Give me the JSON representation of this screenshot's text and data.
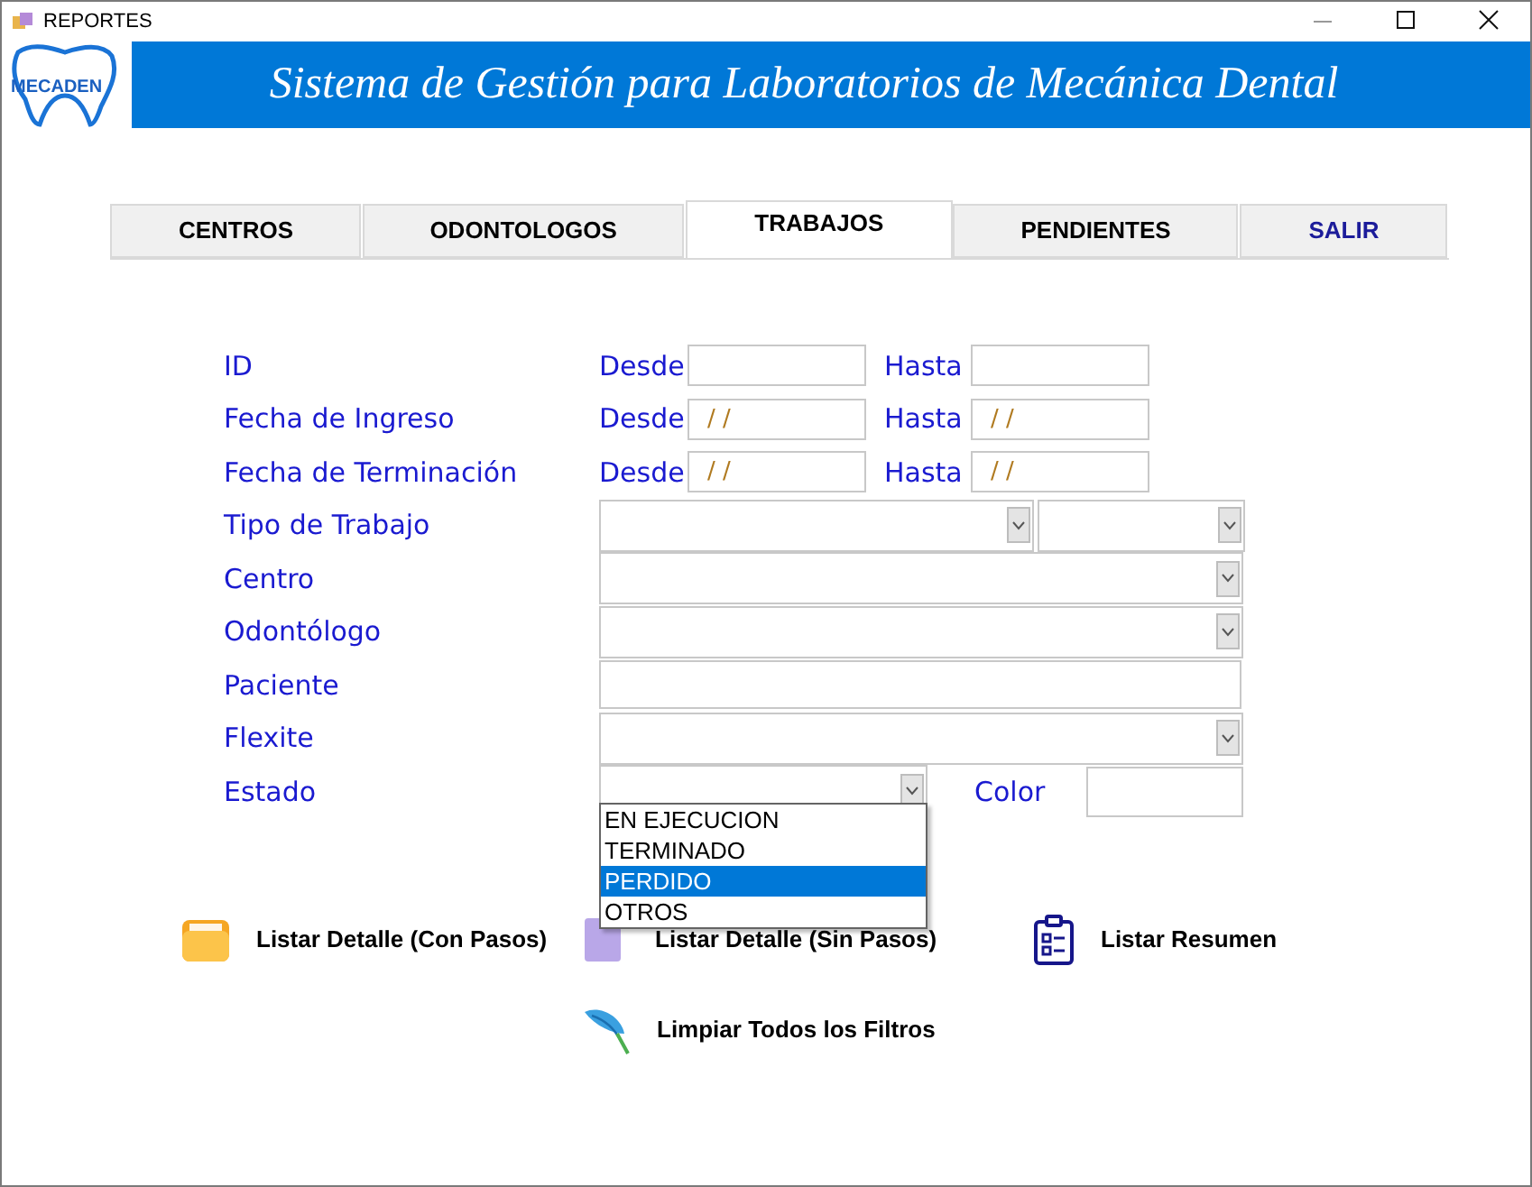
{
  "window": {
    "title": "REPORTES"
  },
  "banner": {
    "logo_text": "MECADEN",
    "title": "Sistema de Gestión para Laboratorios de Mecánica Dental"
  },
  "tabs": [
    {
      "label": "CENTROS",
      "selected": false,
      "kind": "tab"
    },
    {
      "label": "ODONTOLOGOS",
      "selected": false,
      "kind": "tab"
    },
    {
      "label": "TRABAJOS",
      "selected": true,
      "kind": "tab"
    },
    {
      "label": "PENDIENTES",
      "selected": false,
      "kind": "tab"
    },
    {
      "label": "SALIR",
      "selected": false,
      "kind": "exit"
    }
  ],
  "filters": [
    {
      "kind": "range",
      "label": "ID",
      "from_label": "Desde",
      "to_label": "Hasta"
    },
    {
      "kind": "range",
      "label": "Fecha de Ingreso",
      "from_label": "Desde",
      "to_label": "Hasta",
      "from_value": "/ /",
      "to_value": "/ /"
    },
    {
      "kind": "range",
      "label": "Fecha de Terminación",
      "from_label": "Desde",
      "to_label": "Hasta",
      "from_value": "/ /",
      "to_value": "/ /"
    },
    {
      "kind": "combo2",
      "label": "Tipo de Trabajo"
    },
    {
      "kind": "combo",
      "label": "Centro"
    },
    {
      "kind": "combo",
      "label": "Odontólogo"
    },
    {
      "kind": "text",
      "label": "Paciente"
    },
    {
      "kind": "combo",
      "label": "Flexite"
    },
    {
      "kind": "combo_color",
      "label": "Estado",
      "color_label": "Color",
      "expanded": true,
      "options": [
        {
          "label": "EN EJECUCION",
          "selected": false
        },
        {
          "label": "TERMINADO",
          "selected": false
        },
        {
          "label": "PERDIDO",
          "selected": true
        },
        {
          "label": "OTROS",
          "selected": false
        }
      ]
    }
  ],
  "actions": [
    {
      "kind": "folder",
      "label": "Listar Detalle (Con Pasos)"
    },
    {
      "kind": "document",
      "label": "Listar Detalle (Sin Pasos)"
    },
    {
      "kind": "clipboard",
      "label": "Listar Resumen"
    },
    {
      "kind": "feather",
      "label": "Limpiar Todos los Filtros"
    }
  ]
}
